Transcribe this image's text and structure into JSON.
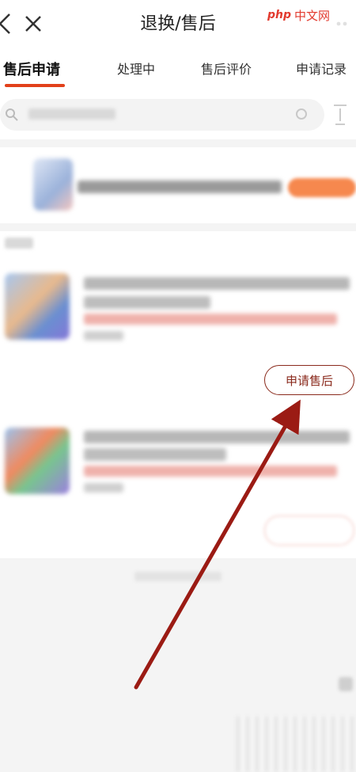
{
  "header": {
    "title": "退换/售后",
    "brand_logo": "php",
    "brand_text": "中文网"
  },
  "tabs": [
    {
      "label": "售后申请",
      "active": true
    },
    {
      "label": "处理中",
      "active": false
    },
    {
      "label": "售后评价",
      "active": false
    },
    {
      "label": "申请记录",
      "active": false
    }
  ],
  "orders": {
    "apply_button": "申请售后"
  },
  "colors": {
    "accent": "#e2401a",
    "button_border": "#8a2a1c",
    "arrow": "#9b1b14"
  }
}
